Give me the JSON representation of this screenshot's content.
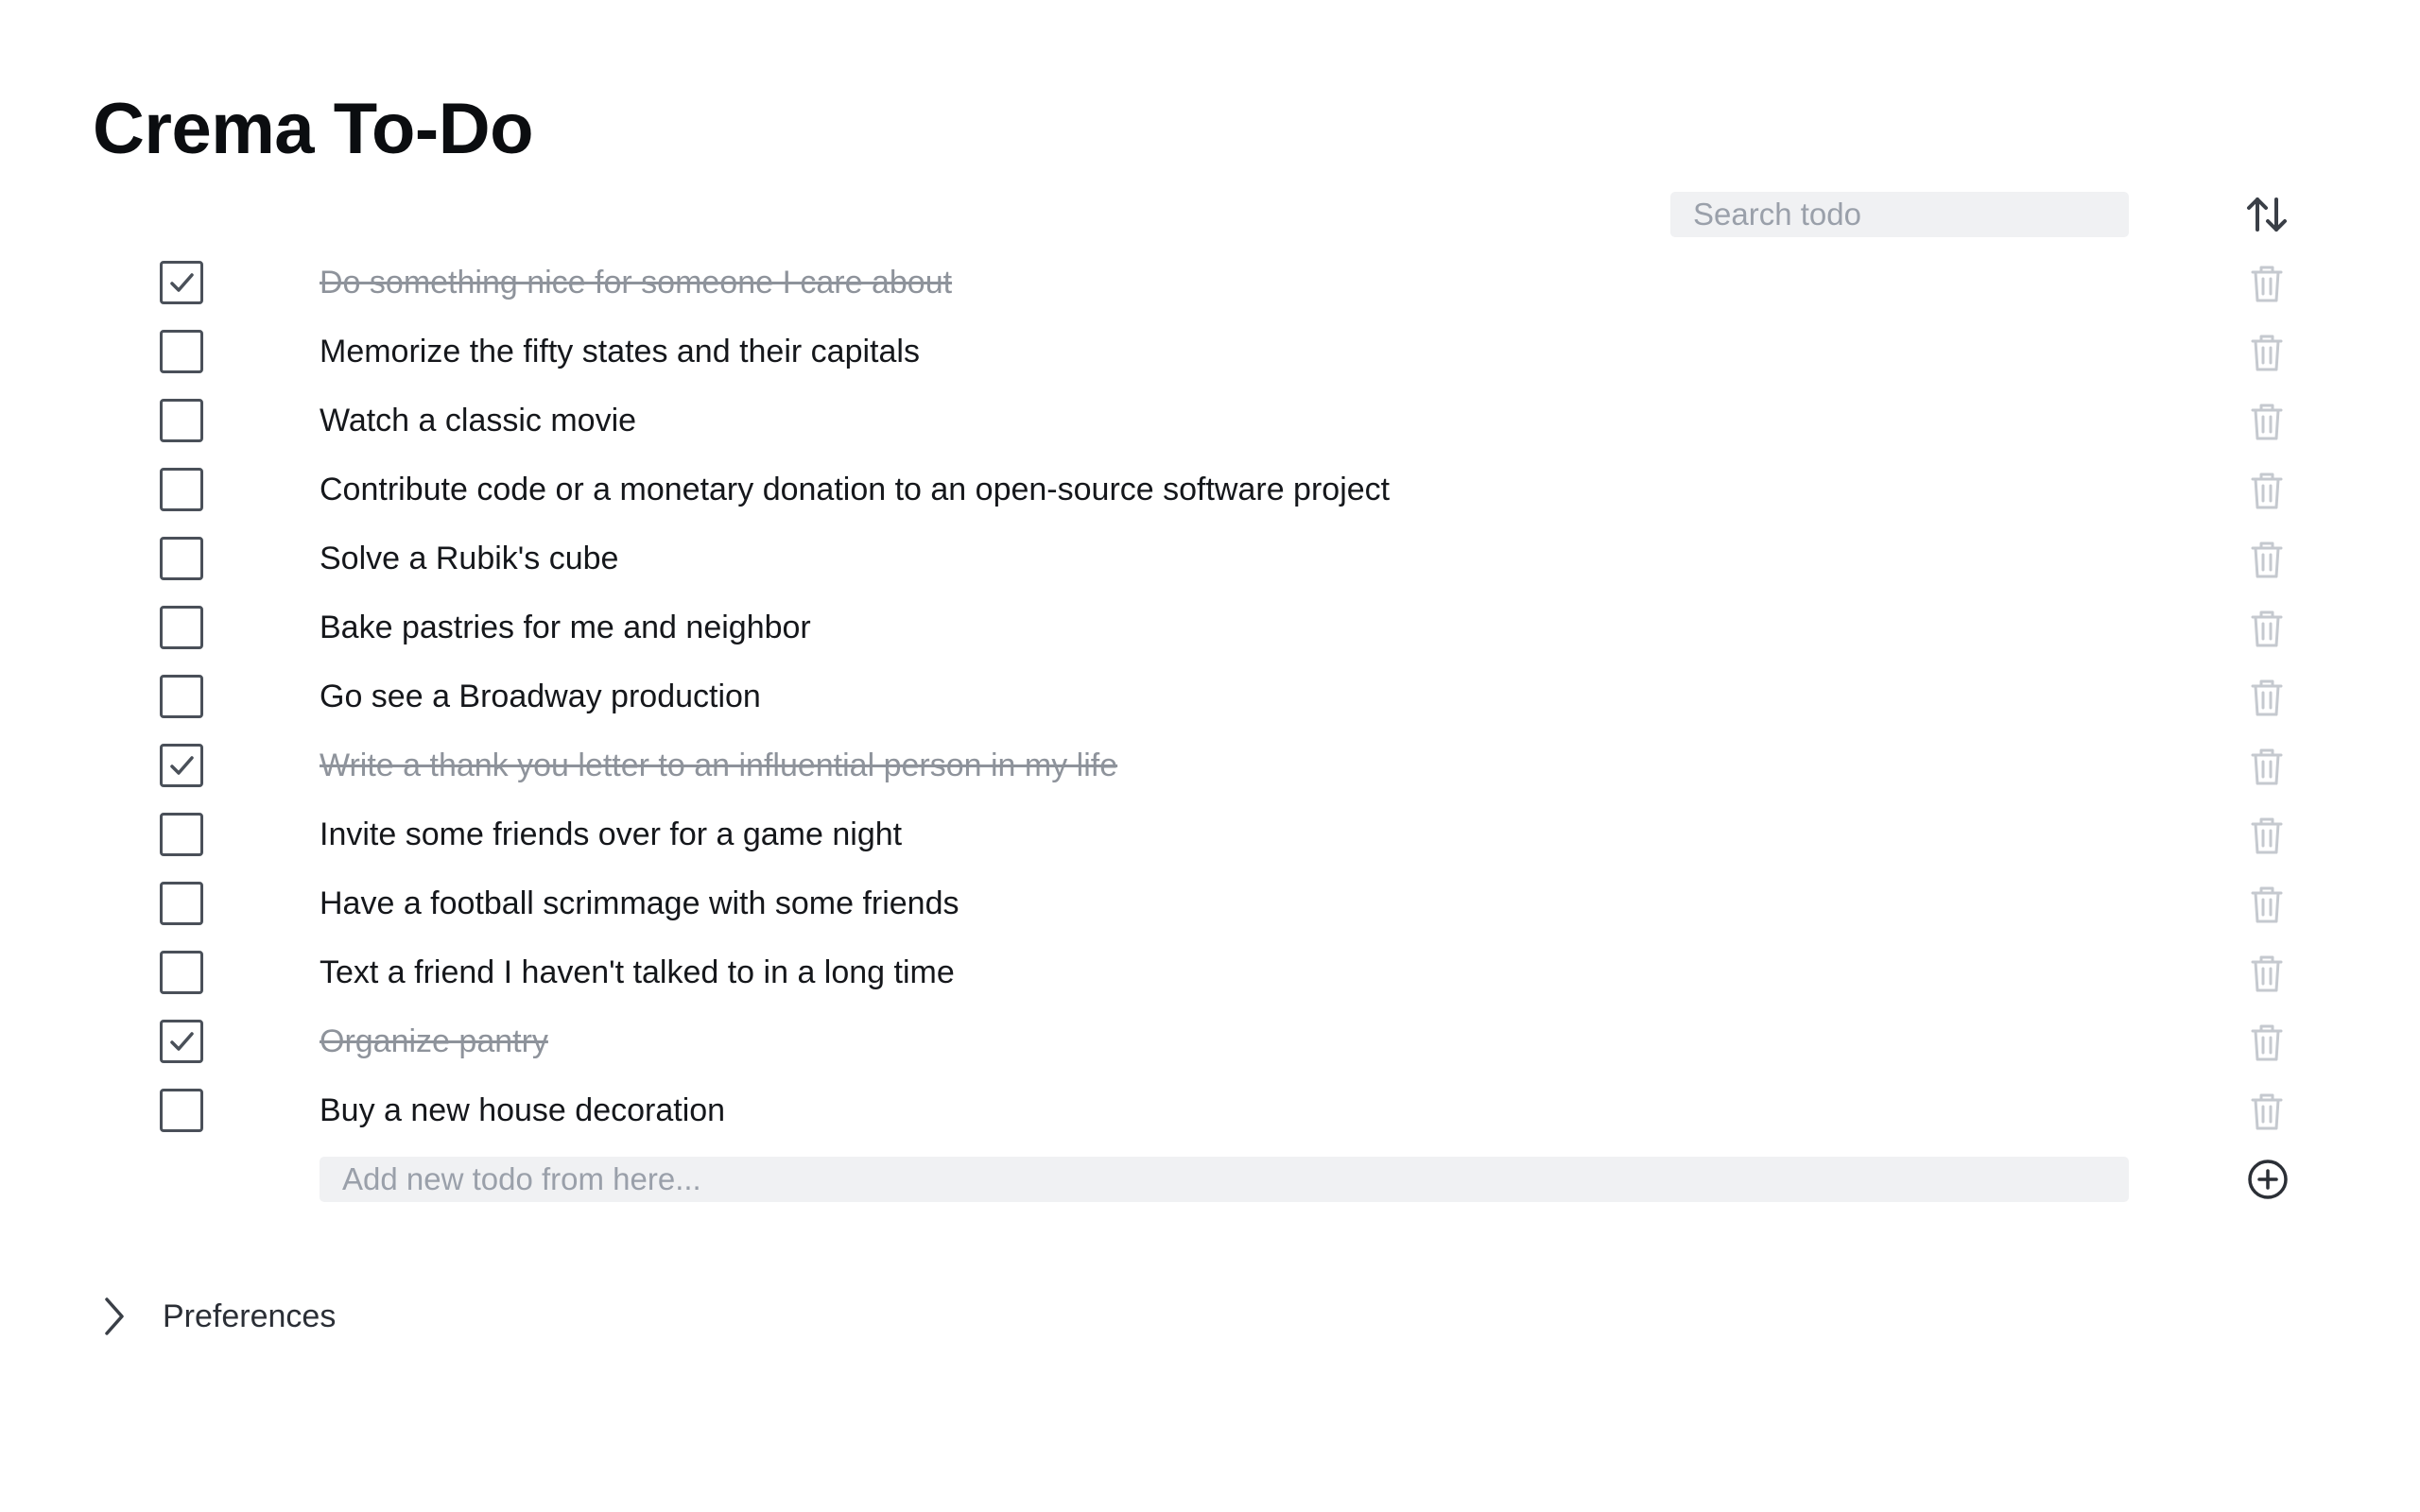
{
  "app": {
    "title": "Crema To-Do"
  },
  "search": {
    "placeholder": "Search todo",
    "value": ""
  },
  "sort": {
    "icon": "sort-arrows-icon"
  },
  "todos": [
    {
      "text": "Do something nice for someone I care about",
      "done": true
    },
    {
      "text": "Memorize the fifty states and their capitals",
      "done": false
    },
    {
      "text": "Watch a classic movie",
      "done": false
    },
    {
      "text": "Contribute code or a monetary donation to an open-source software project",
      "done": false
    },
    {
      "text": "Solve a Rubik's cube",
      "done": false
    },
    {
      "text": "Bake pastries for me and neighbor",
      "done": false
    },
    {
      "text": "Go see a Broadway production",
      "done": false
    },
    {
      "text": "Write a thank you letter to an influential person in my life",
      "done": true
    },
    {
      "text": "Invite some friends over for a game night",
      "done": false
    },
    {
      "text": "Have a football scrimmage with some friends",
      "done": false
    },
    {
      "text": "Text a friend I haven't talked to in a long time",
      "done": false
    },
    {
      "text": "Organize pantry",
      "done": true
    },
    {
      "text": "Buy a new house decoration",
      "done": false
    }
  ],
  "add_todo": {
    "placeholder": "Add new todo from here...",
    "value": ""
  },
  "preferences": {
    "label": "Preferences",
    "expanded": false
  },
  "colors": {
    "text": "#15171b",
    "completed_text": "#8e939b",
    "input_background": "#f0f1f3",
    "icon_muted": "#c5c9cf",
    "icon_dark": "#3a3f47"
  }
}
